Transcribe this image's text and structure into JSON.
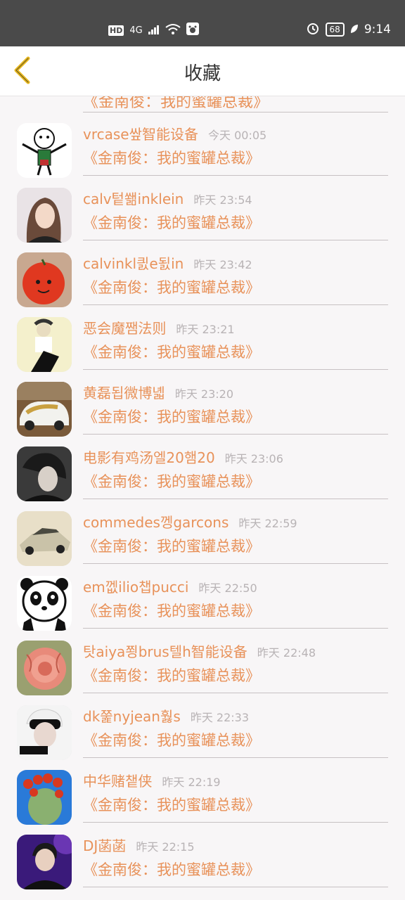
{
  "status_bar": {
    "left_hd": "HD",
    "left_net": "4G",
    "battery": "68",
    "time": "9:14"
  },
  "header": {
    "title": "收藏",
    "back_icon": "chevron-left-icon",
    "accent": "#e8b820"
  },
  "list_partial_top": {
    "book": "《金南俊：我的蜜罐总裁》"
  },
  "items": [
    {
      "name": "vrcase쌒智能设备",
      "time": "今天 00:05",
      "book": "《金南俊：我的蜜罐总裁》"
    },
    {
      "name": "calv텉쐚inklein",
      "time": "昨天 23:54",
      "book": "《金南俊：我的蜜罐总裁》"
    },
    {
      "name": "calvinkl킔e됤in",
      "time": "昨天 23:42",
      "book": "《金南俊：我的蜜罐总裁》"
    },
    {
      "name": "恶会魔쨈法则",
      "time": "昨天 23:21",
      "book": "《金南俊：我的蜜罐总裁》"
    },
    {
      "name": "黄磊됩微博녧",
      "time": "昨天 23:20",
      "book": "《金南俊：我的蜜罐总裁》"
    },
    {
      "name": "电影有鸡汤엘20햄20",
      "time": "昨天 23:06",
      "book": "《金南俊：我的蜜罐总裁》"
    },
    {
      "name": "commedes껭garcons",
      "time": "昨天 22:59",
      "book": "《金南俊：我的蜜罐总裁》"
    },
    {
      "name": "em껪ilio챕pucci",
      "time": "昨天 22:50",
      "book": "《金南俊：我的蜜罐总裁》"
    },
    {
      "name": "탓aiya쬥brus텔h智能设备",
      "time": "昨天 22:48",
      "book": "《金南俊：我的蜜罐总裁》"
    },
    {
      "name": "dk쭕nyjean훯s",
      "time": "昨天 22:33",
      "book": "《金南俊：我的蜜罐总裁》"
    },
    {
      "name": "中华赌챝侠",
      "time": "昨天 22:19",
      "book": "《金南俊：我的蜜罐总裁》"
    },
    {
      "name": "DJ菡菡",
      "time": "昨天 22:15",
      "book": "《金南俊：我的蜜罐总裁》"
    }
  ],
  "colors": {
    "name_text": "#e8925a",
    "time_text": "#b8b3b5",
    "background": "#f8f6f7"
  }
}
